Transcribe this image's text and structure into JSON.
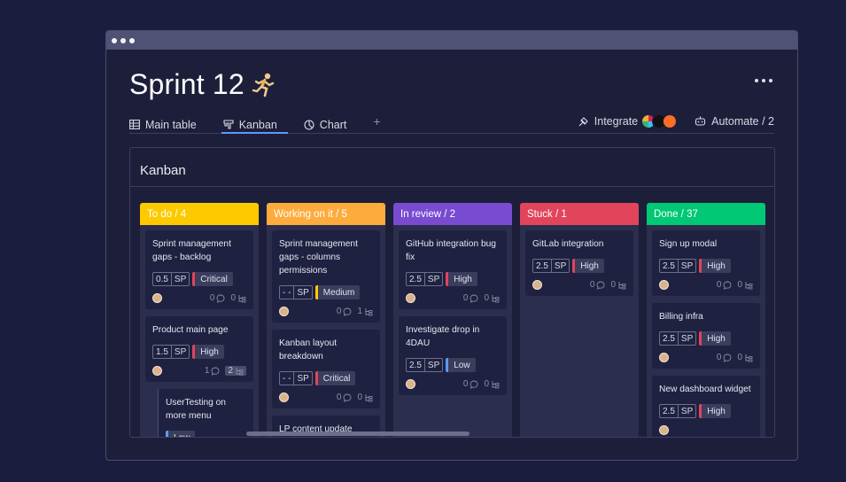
{
  "page": {
    "title": "Sprint 12"
  },
  "tabs": [
    {
      "label": "Main table"
    },
    {
      "label": "Kanban"
    },
    {
      "label": "Chart"
    }
  ],
  "toolbar": {
    "add_tab": "+",
    "integrate": "Integrate",
    "automate": "Automate / 2"
  },
  "board": {
    "title": "Kanban",
    "columns": [
      {
        "header": "To do / 4",
        "color": "#fdca00",
        "cards": [
          {
            "title": "Sprint management gaps - backlog",
            "sp": "0.5",
            "sp_label": "SP",
            "priority": "Critical",
            "priority_color": "#e2445c",
            "comments": "0",
            "subitems": "0"
          },
          {
            "title": "Product main page",
            "sp": "1.5",
            "sp_label": "SP",
            "priority": "High",
            "priority_color": "#e2445c",
            "comments": "1",
            "subitems": "2"
          }
        ],
        "subitem": {
          "title": "UserTesting on more menu",
          "priority": "Low",
          "priority_color": "#579bfc"
        }
      },
      {
        "header": "Working on it / 5",
        "color": "#fdab3d",
        "cards": [
          {
            "title": "Sprint management gaps - columns permissions",
            "sp": "- -",
            "sp_label": "SP",
            "priority": "Medium",
            "priority_color": "#fdca00",
            "comments": "0",
            "subitems": "1"
          },
          {
            "title": "Kanban layout breakdown",
            "sp": "- -",
            "sp_label": "SP",
            "priority": "Critical",
            "priority_color": "#e2445c",
            "comments": "0",
            "subitems": "0"
          },
          {
            "title": "LP content update"
          }
        ]
      },
      {
        "header": "In review / 2",
        "color": "#784bd1",
        "cards": [
          {
            "title": "GitHub integration bug fix",
            "sp": "2.5",
            "sp_label": "SP",
            "priority": "High",
            "priority_color": "#e2445c",
            "comments": "0",
            "subitems": "0"
          },
          {
            "title": "Investigate drop in 4DAU",
            "sp": "2.5",
            "sp_label": "SP",
            "priority": "Low",
            "priority_color": "#579bfc",
            "comments": "0",
            "subitems": "0"
          }
        ]
      },
      {
        "header": "Stuck / 1",
        "color": "#e2445c",
        "cards": [
          {
            "title": "GitLab integration",
            "sp": "2.5",
            "sp_label": "SP",
            "priority": "High",
            "priority_color": "#e2445c",
            "comments": "0",
            "subitems": "0"
          }
        ]
      },
      {
        "header": "Done  / 37",
        "color": "#00c875",
        "cards": [
          {
            "title": "Sign up modal",
            "sp": "2.5",
            "sp_label": "SP",
            "priority": "High",
            "priority_color": "#e2445c",
            "comments": "0",
            "subitems": "0"
          },
          {
            "title": "Billing infra",
            "sp": "2.5",
            "sp_label": "SP",
            "priority": "High",
            "priority_color": "#e2445c",
            "comments": "0",
            "subitems": "0"
          },
          {
            "title": "New dashboard widget",
            "sp": "2.5",
            "sp_label": "SP",
            "priority": "High",
            "priority_color": "#e2445c"
          }
        ]
      }
    ]
  },
  "colors": {
    "background": "#1a1d3d",
    "accent": "#579bfc"
  }
}
